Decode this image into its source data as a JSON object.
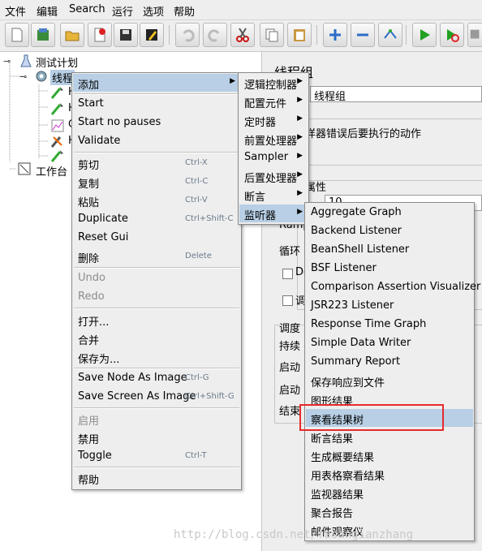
{
  "menubar": {
    "file": "文件",
    "edit": "编辑",
    "search": "Search",
    "run": "运行",
    "options": "选项",
    "help": "帮助"
  },
  "tree": {
    "test_plan": "测试计划",
    "thread_group": "线程",
    "child_h1": "H",
    "child_h2": "H",
    "child_c": "C",
    "child_h3": "H",
    "workbench": "工作台"
  },
  "right_panel": {
    "title": "线程组",
    "name_value": "线程组",
    "error_action": "样器错误后要执行的动作",
    "props": "属性",
    "threads_value": "10",
    "ramp": "Ramp",
    "loop": "循环",
    "de": "De",
    "tiao": "调",
    "sched": "调度",
    "duration": "持续",
    "startup1": "启动",
    "startup2": "启动",
    "end": "结束"
  },
  "context_menu": {
    "add": "添加",
    "start": "Start",
    "start_no_pauses": "Start no pauses",
    "validate": "Validate",
    "cut": "剪切",
    "cut_sc": "Ctrl-X",
    "copy": "复制",
    "copy_sc": "Ctrl-C",
    "paste": "粘贴",
    "paste_sc": "Ctrl-V",
    "duplicate": "Duplicate",
    "duplicate_sc": "Ctrl+Shift-C",
    "reset_gui": "Reset Gui",
    "delete": "删除",
    "delete_sc": "Delete",
    "undo": "Undo",
    "redo": "Redo",
    "open": "打开...",
    "merge": "合并",
    "save_as": "保存为...",
    "save_node_image": "Save Node As Image",
    "save_node_image_sc": "Ctrl-G",
    "save_screen_image": "Save Screen As Image",
    "save_screen_image_sc": "Ctrl+Shift-G",
    "enable": "启用",
    "disable": "禁用",
    "toggle": "Toggle",
    "toggle_sc": "Ctrl-T",
    "help": "帮助"
  },
  "add_submenu": {
    "logic_controller": "逻辑控制器",
    "config_element": "配置元件",
    "timer": "定时器",
    "pre_processor": "前置处理器",
    "sampler": "Sampler",
    "post_processor": "后置处理器",
    "assertion": "断言",
    "listener": "监听器"
  },
  "listener_submenu": {
    "aggregate_graph": "Aggregate Graph",
    "backend_listener": "Backend Listener",
    "beanshell_listener": "BeanShell Listener",
    "bsf_listener": "BSF Listener",
    "comparison_visualizer": "Comparison Assertion Visualizer",
    "jsr223_listener": "JSR223 Listener",
    "response_time_graph": "Response Time Graph",
    "simple_data_writer": "Simple Data Writer",
    "summary_report": "Summary Report",
    "save_responses": "保存响应到文件",
    "graph_results": "图形结果",
    "view_results_tree": "察看结果树",
    "assertion_results": "断言结果",
    "generate_summary": "生成概要结果",
    "view_results_table": "用表格察看结果",
    "monitor_results": "监视器结果",
    "aggregate_report": "聚合报告",
    "mailer_visualizer": "邮件观察仪"
  },
  "watermark": "http://blog.csdn.net/fasangianzhang",
  "colors": {
    "selection": "#b8cfe5",
    "highlight_box": "#e8292c",
    "menu_bg": "#eeeeee"
  }
}
